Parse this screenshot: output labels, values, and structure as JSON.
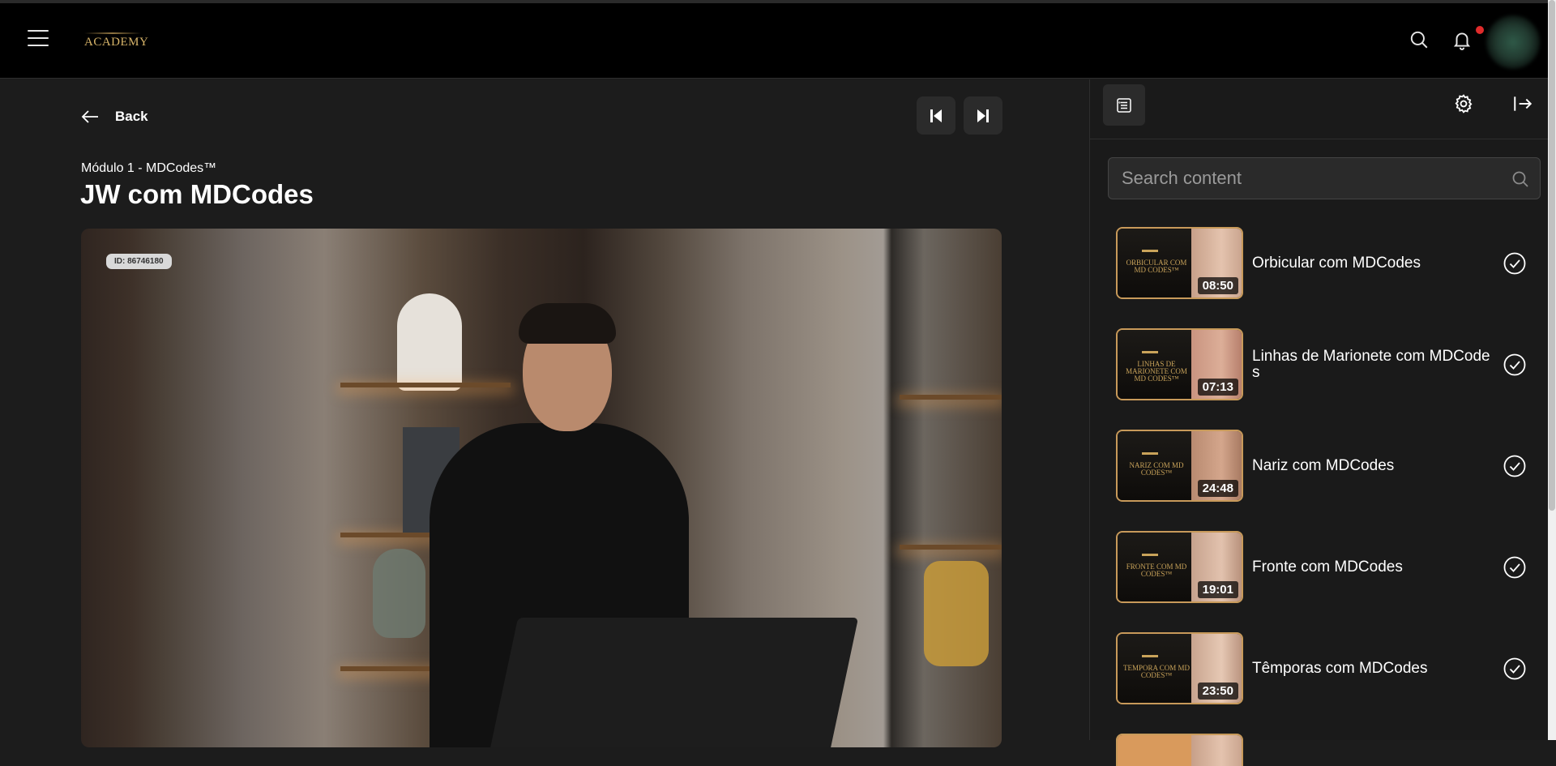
{
  "header": {
    "logo_text": "ACADEMY",
    "notification_dot_color": "#e02b2b"
  },
  "player": {
    "back_label": "Back",
    "module_label": "Módulo 1 - MDCodes™",
    "lesson_title": "JW com MDCodes",
    "video_id": "ID: 86746180"
  },
  "sidebar": {
    "search_placeholder": "Search content",
    "lessons": [
      {
        "title": "Orbicular com MDCodes",
        "duration": "08:50",
        "thumb_text": "ORBICULAR COM MD CODES™",
        "completed": true
      },
      {
        "title": "Linhas de Marionete com MDCodes",
        "duration": "07:13",
        "thumb_text": "LINHAS DE MARIONETE COM MD CODES™",
        "completed": true
      },
      {
        "title": "Nariz com MDCodes",
        "duration": "24:48",
        "thumb_text": "NARIZ COM MD CODES™",
        "completed": true
      },
      {
        "title": "Fronte com MDCodes",
        "duration": "19:01",
        "thumb_text": "FRONTE COM MD CODES™",
        "completed": true
      },
      {
        "title": "Têmporas com MDCodes",
        "duration": "23:50",
        "thumb_text": "TEMPORA COM MD CODES™",
        "completed": true
      }
    ]
  },
  "colors": {
    "accent_gold": "#c9a35a",
    "background": "#1c1c1c",
    "header_bg": "#000000"
  }
}
